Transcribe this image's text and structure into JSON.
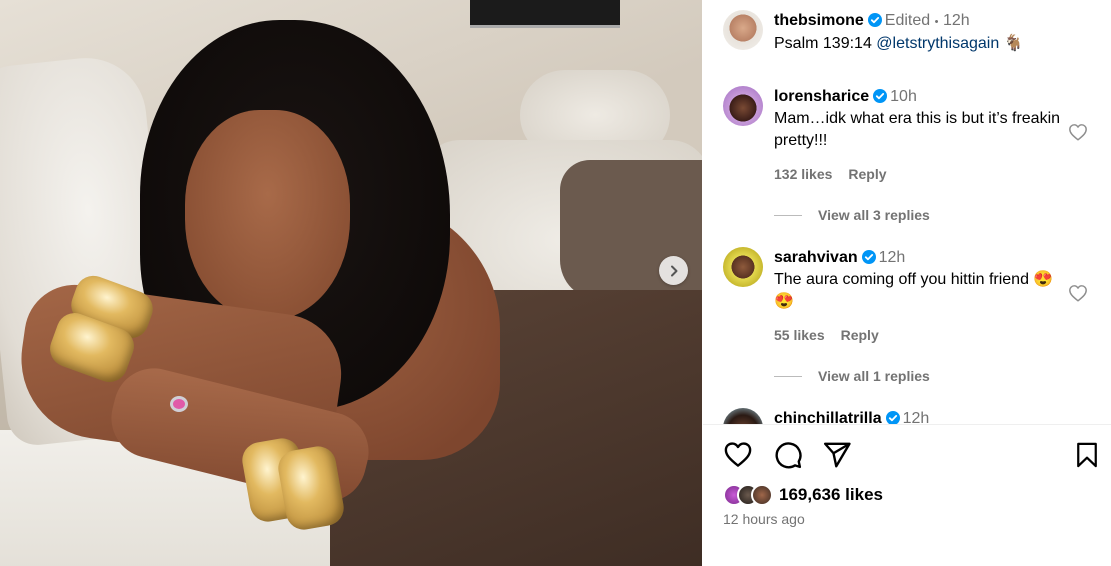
{
  "post": {
    "author": "thebsimone",
    "edited": "Edited",
    "dot": "•",
    "time": "12h",
    "caption_text": "Psalm 139:14",
    "caption_mention": "@letstrythisagain",
    "caption_emoji": "🐐"
  },
  "comments": [
    {
      "username": "lorensharice",
      "time": "10h",
      "text": "Mam…idk what era this is but it’s freakin pretty!!!",
      "likes": "132 likes",
      "reply": "Reply",
      "view_replies": "View all 3 replies"
    },
    {
      "username": "sarahvivan",
      "time": "12h",
      "text": "The aura coming off you hittin friend 😍😍",
      "likes": "55 likes",
      "reply": "Reply",
      "view_replies": "View all 1 replies"
    },
    {
      "username": "chinchillatrilla",
      "time": "12h"
    }
  ],
  "footer": {
    "likes": "169,636 likes",
    "posted": "12 hours ago"
  },
  "colors": {
    "verified": "#0095f6",
    "muted": "#737373",
    "link": "#00376b"
  },
  "icons": [
    "heart-icon",
    "comment-icon",
    "share-icon",
    "bookmark-icon",
    "chevron-right-icon",
    "verified-badge-icon"
  ]
}
